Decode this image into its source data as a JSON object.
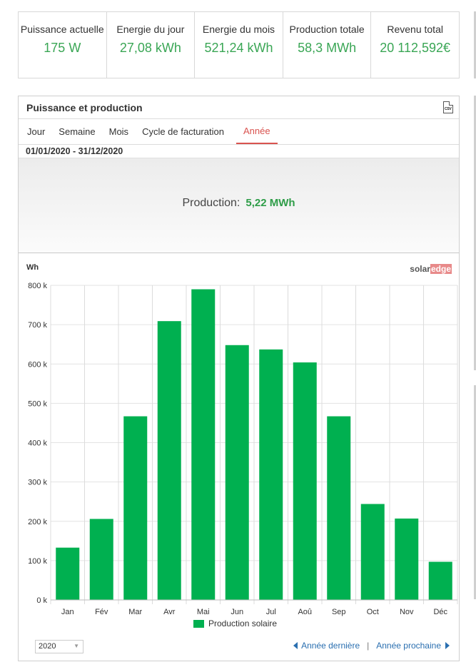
{
  "kpis": [
    {
      "label": "Puissance actuelle",
      "value": "175 W"
    },
    {
      "label": "Energie du jour",
      "value": "27,08 kWh"
    },
    {
      "label": "Energie du mois",
      "value": "521,24 kWh"
    },
    {
      "label": "Production totale",
      "value": "58,3 MWh"
    },
    {
      "label": "Revenu total",
      "value": "20 112,592€"
    }
  ],
  "panel": {
    "title": "Puissance et production",
    "csv_icon_text": "CSV",
    "tabs": [
      {
        "label": "Jour",
        "active": false
      },
      {
        "label": "Semaine",
        "active": false
      },
      {
        "label": "Mois",
        "active": false
      },
      {
        "label": "Cycle de facturation",
        "active": false
      },
      {
        "label": "Année",
        "active": true
      }
    ],
    "date_range": "01/01/2020 - 31/12/2020",
    "summary_label": "Production:",
    "summary_value": "5,22 MWh",
    "brand_part1": "solar",
    "brand_part2": "edge",
    "year_select": "2020",
    "prev_link": "Année dernière",
    "separator": "|",
    "next_link": "Année prochaine"
  },
  "colors": {
    "bar": "#00b050",
    "kpi_value": "#3aa655",
    "active_tab": "#d9534f",
    "link": "#2a6fb0"
  },
  "chart_data": {
    "type": "bar",
    "ylabel": "Wh",
    "ylim": [
      0,
      800000
    ],
    "yticks": [
      0,
      100000,
      200000,
      300000,
      400000,
      500000,
      600000,
      700000,
      800000
    ],
    "ytick_labels": [
      "0 k",
      "100 k",
      "200 k",
      "300 k",
      "400 k",
      "500 k",
      "600 k",
      "700 k",
      "800 k"
    ],
    "categories": [
      "Jan",
      "Fév",
      "Mar",
      "Avr",
      "Mai",
      "Jun",
      "Jul",
      "Aoû",
      "Sep",
      "Oct",
      "Nov",
      "Déc"
    ],
    "series": [
      {
        "name": "Production solaire",
        "values": [
          133000,
          206000,
          467000,
          709000,
          790000,
          648000,
          637000,
          604000,
          467000,
          244000,
          207000,
          97000
        ]
      }
    ],
    "grid": true,
    "legend": "bottom"
  }
}
